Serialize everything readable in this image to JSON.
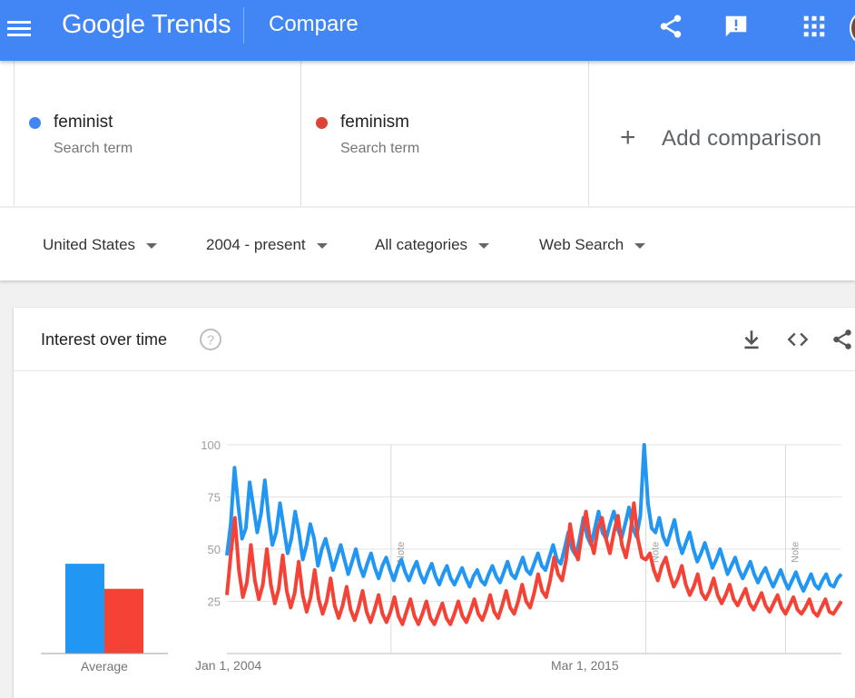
{
  "header": {
    "logo_google": "Google",
    "logo_trends": "Trends",
    "page_title": "Compare",
    "brand_color": "#4285f4"
  },
  "terms": [
    {
      "name": "feminist",
      "subtitle": "Search term",
      "color": "#4285f4"
    },
    {
      "name": "feminism",
      "subtitle": "Search term",
      "color": "#db4437"
    }
  ],
  "add_comparison": {
    "icon": "+",
    "label": "Add comparison"
  },
  "filters": [
    {
      "label": "United States"
    },
    {
      "label": "2004 - present"
    },
    {
      "label": "All categories"
    },
    {
      "label": "Web Search"
    }
  ],
  "card": {
    "title": "Interest over time",
    "icons": [
      "help-icon",
      "download-icon",
      "embed-icon",
      "share-icon"
    ]
  },
  "chart_data": {
    "type": "line",
    "title": "",
    "ylim": [
      0,
      100
    ],
    "y_ticks": [
      "100",
      "75",
      "50",
      "25"
    ],
    "x_tick_labels": [
      "Jan 1, 2004",
      "Mar 1, 2015"
    ],
    "note_label": "Note",
    "note_dates": [
      2008.7,
      2016.0,
      2020.0
    ],
    "average": {
      "label": "Average",
      "values": [
        {
          "series": "feminist",
          "value": 43
        },
        {
          "series": "feminism",
          "value": 31
        }
      ]
    },
    "x_start": 2004.0,
    "x_end": 2021.6,
    "series": [
      {
        "name": "feminist",
        "color": "#2196f3",
        "values": [
          47,
          62,
          89,
          71,
          55,
          60,
          82,
          70,
          58,
          67,
          83,
          65,
          52,
          58,
          72,
          60,
          48,
          55,
          68,
          58,
          45,
          52,
          62,
          55,
          42,
          50,
          55,
          48,
          40,
          46,
          52,
          45,
          38,
          44,
          50,
          42,
          37,
          43,
          48,
          41,
          36,
          42,
          46,
          40,
          35,
          41,
          45,
          39,
          35,
          40,
          44,
          38,
          34,
          39,
          43,
          37,
          33,
          38,
          42,
          36,
          33,
          37,
          41,
          36,
          32,
          37,
          40,
          35,
          33,
          38,
          42,
          37,
          34,
          39,
          44,
          38,
          36,
          41,
          46,
          40,
          38,
          43,
          48,
          42,
          40,
          46,
          52,
          45,
          43,
          50,
          58,
          50,
          47,
          55,
          65,
          56,
          52,
          60,
          68,
          58,
          55,
          62,
          68,
          60,
          55,
          62,
          70,
          60,
          56,
          66,
          100,
          72,
          60,
          58,
          65,
          56,
          52,
          58,
          64,
          54,
          48,
          53,
          58,
          50,
          44,
          48,
          53,
          47,
          41,
          45,
          50,
          44,
          38,
          42,
          46,
          40,
          36,
          40,
          44,
          38,
          34,
          38,
          41,
          36,
          32,
          36,
          40,
          35,
          31,
          35,
          39,
          34,
          30,
          34,
          38,
          33,
          31,
          35,
          38,
          33,
          32,
          36,
          38
        ]
      },
      {
        "name": "feminism",
        "color": "#f44336",
        "values": [
          28,
          48,
          65,
          40,
          27,
          34,
          52,
          35,
          26,
          33,
          50,
          33,
          24,
          31,
          47,
          30,
          22,
          29,
          44,
          28,
          20,
          27,
          40,
          26,
          19,
          25,
          36,
          23,
          17,
          23,
          32,
          21,
          16,
          22,
          30,
          20,
          15,
          21,
          28,
          19,
          15,
          20,
          27,
          18,
          14,
          20,
          26,
          18,
          14,
          19,
          25,
          17,
          14,
          19,
          24,
          17,
          14,
          19,
          25,
          18,
          15,
          20,
          26,
          19,
          16,
          21,
          28,
          20,
          17,
          23,
          30,
          22,
          19,
          25,
          33,
          25,
          22,
          29,
          38,
          30,
          27,
          35,
          46,
          38,
          35,
          45,
          62,
          50,
          45,
          58,
          68,
          55,
          48,
          60,
          65,
          55,
          48,
          58,
          66,
          52,
          46,
          56,
          72,
          55,
          46,
          45,
          48,
          40,
          35,
          42,
          46,
          38,
          32,
          36,
          42,
          33,
          28,
          32,
          38,
          29,
          26,
          30,
          36,
          28,
          24,
          28,
          33,
          26,
          23,
          27,
          31,
          24,
          21,
          25,
          29,
          23,
          20,
          24,
          28,
          22,
          19,
          23,
          27,
          21,
          19,
          22,
          26,
          20,
          18,
          22,
          26,
          20,
          19,
          22,
          25
        ]
      }
    ]
  }
}
